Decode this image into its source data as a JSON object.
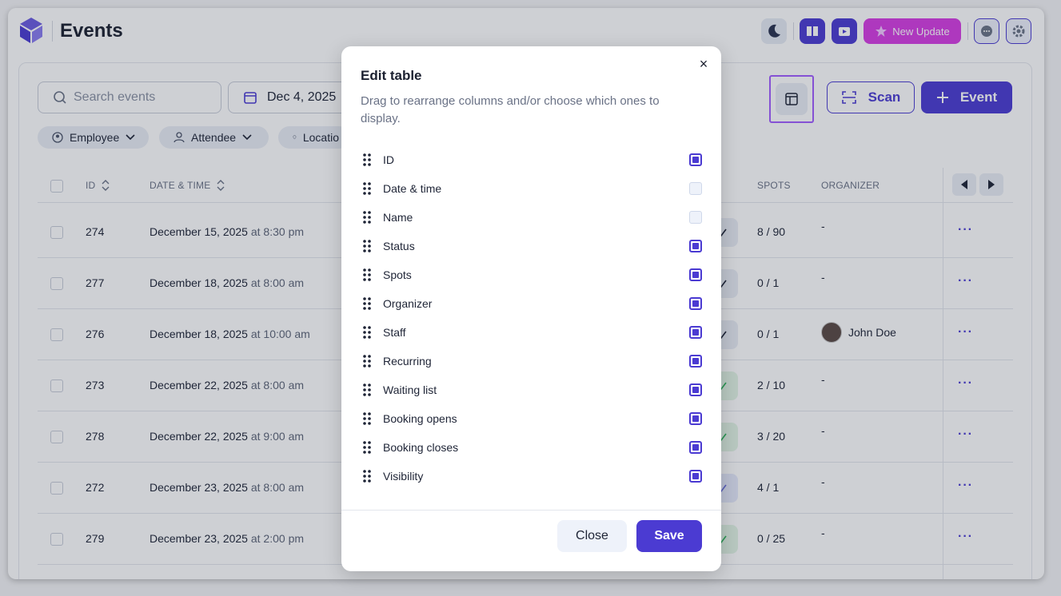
{
  "app": {
    "title": "Events"
  },
  "topbar": {
    "new_update_label": "New Update"
  },
  "toolbar": {
    "search_placeholder": "Search events",
    "date_value": "Dec 4, 2025",
    "scan_label": "Scan",
    "event_label": "Event",
    "filters": {
      "employee": "Employee",
      "attendee": "Attendee",
      "location": "Locatio"
    }
  },
  "table": {
    "headers": {
      "id": "ID",
      "date_time": "DATE & TIME",
      "spots": "SPOTS",
      "organizer": "ORGANIZER"
    },
    "rows": [
      {
        "id": "274",
        "date": "December 15, 2025",
        "time": "at 8:30 pm",
        "spots": "8 / 90",
        "organizer": "-"
      },
      {
        "id": "277",
        "date": "December 18, 2025",
        "time": "at 8:00 am",
        "spots": "0 / 1",
        "organizer": "-"
      },
      {
        "id": "276",
        "date": "December 18, 2025",
        "time": "at 10:00 am",
        "spots": "0 / 1",
        "organizer": "John Doe"
      },
      {
        "id": "273",
        "date": "December 22, 2025",
        "time": "at 8:00 am",
        "spots": "2 / 10",
        "organizer": "-"
      },
      {
        "id": "278",
        "date": "December 22, 2025",
        "time": "at 9:00 am",
        "spots": "3 / 20",
        "organizer": "-"
      },
      {
        "id": "272",
        "date": "December 23, 2025",
        "time": "at 8:00 am",
        "spots": "4 / 1",
        "organizer": "-"
      },
      {
        "id": "279",
        "date": "December 23, 2025",
        "time": "at 2:00 pm",
        "spots": "0 / 25",
        "organizer": "-"
      }
    ],
    "more_label": "···"
  },
  "modal": {
    "title": "Edit table",
    "close_glyph": "×",
    "description": "Drag to rearrange columns and/or choose which ones to display.",
    "columns": [
      {
        "label": "ID",
        "checked": true,
        "disabled": false
      },
      {
        "label": "Date & time",
        "checked": true,
        "disabled": true
      },
      {
        "label": "Name",
        "checked": true,
        "disabled": true
      },
      {
        "label": "Status",
        "checked": true,
        "disabled": false
      },
      {
        "label": "Spots",
        "checked": true,
        "disabled": false
      },
      {
        "label": "Organizer",
        "checked": true,
        "disabled": false
      },
      {
        "label": "Staff",
        "checked": true,
        "disabled": false
      },
      {
        "label": "Recurring",
        "checked": true,
        "disabled": false
      },
      {
        "label": "Waiting list",
        "checked": true,
        "disabled": false
      },
      {
        "label": "Booking opens",
        "checked": true,
        "disabled": false
      },
      {
        "label": "Booking closes",
        "checked": true,
        "disabled": false
      },
      {
        "label": "Visibility",
        "checked": true,
        "disabled": false
      }
    ],
    "close_label": "Close",
    "save_label": "Save"
  }
}
